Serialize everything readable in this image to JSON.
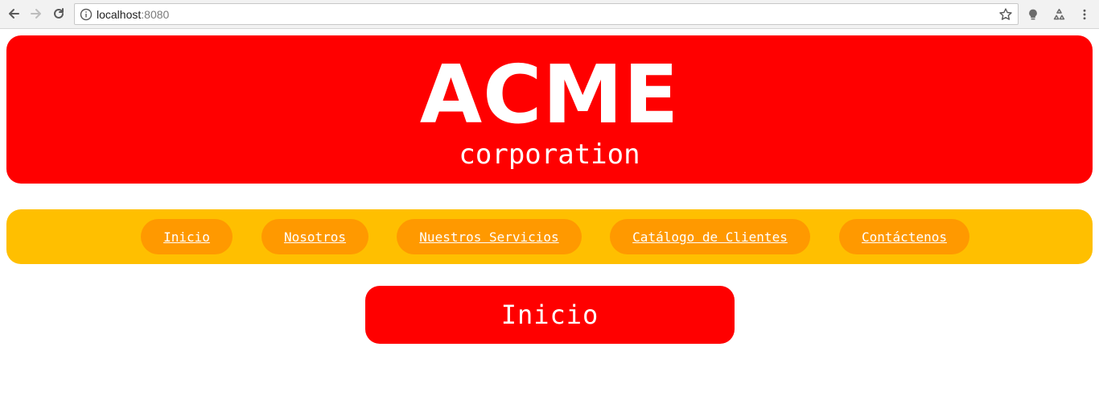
{
  "browser": {
    "url_host": "localhost",
    "url_port": ":8080",
    "icons": {
      "back": "back-arrow-icon",
      "forward": "forward-arrow-icon",
      "reload": "reload-icon",
      "info": "info-icon",
      "bookmark": "star-icon",
      "ext1": "lightbulb-icon",
      "ext2": "recycle-icon",
      "menu": "kebab-menu-icon"
    }
  },
  "header": {
    "title": "ACME",
    "subtitle": "corporation"
  },
  "nav": {
    "items": [
      {
        "label": "Inicio"
      },
      {
        "label": "Nosotros"
      },
      {
        "label": "Nuestros Servicios"
      },
      {
        "label": "Catálogo de Clientes"
      },
      {
        "label": "Contáctenos"
      }
    ]
  },
  "main": {
    "heading": "Inicio"
  },
  "colors": {
    "primary_red": "#ff0000",
    "nav_bar": "#ffbf00",
    "nav_pill": "#ff9900",
    "text_on_color": "#ffffff"
  }
}
